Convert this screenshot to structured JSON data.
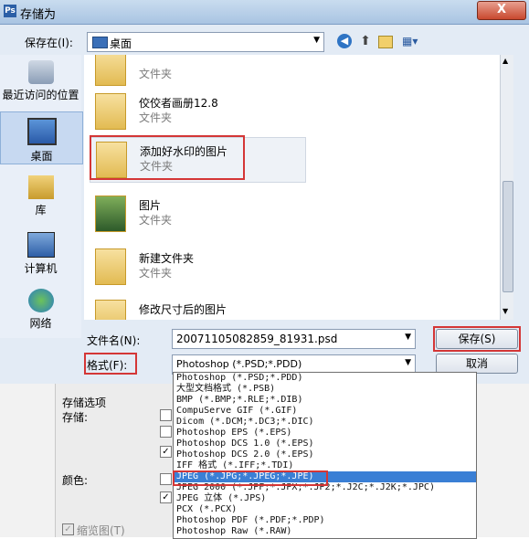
{
  "window": {
    "title": "存储为",
    "close": "X",
    "app_icon": "Ps"
  },
  "toolbar": {
    "save_in_label": "保存在(I):",
    "location": "桌面",
    "nav_icons": [
      "back-icon",
      "up-icon",
      "new-folder-icon",
      "view-menu-icon"
    ]
  },
  "sidebar": {
    "items": [
      {
        "label": "最近访问的位置",
        "icon": "recent-places-icon"
      },
      {
        "label": "桌面",
        "icon": "desktop-icon",
        "selected": true
      },
      {
        "label": "库",
        "icon": "library-icon"
      },
      {
        "label": "计算机",
        "icon": "computer-icon"
      },
      {
        "label": "网络",
        "icon": "network-icon"
      }
    ]
  },
  "files": [
    {
      "name": "",
      "type": "文件夹"
    },
    {
      "name": "佼佼者画册12.8",
      "type": "文件夹"
    },
    {
      "name": "添加好水印的图片",
      "type": "文件夹",
      "selected": true
    },
    {
      "name": "图片",
      "type": "文件夹"
    },
    {
      "name": "新建文件夹",
      "type": "文件夹"
    },
    {
      "name": "修改尺寸后的图片",
      "type": ""
    }
  ],
  "form": {
    "filename_label": "文件名(N):",
    "filename_value": "20071105082859_81931.psd",
    "format_label": "格式(F):",
    "format_value": "Photoshop (*.PSD;*.PDD)",
    "save_button": "保存(S)",
    "cancel_button": "取消"
  },
  "options": {
    "title": "存储选项",
    "storage_label": "存储:",
    "color_label": "颜色:",
    "thumbnail_label": "缩览图(T)"
  },
  "format_options": [
    "Photoshop (*.PSD;*.PDD)",
    "大型文档格式 (*.PSB)",
    "BMP (*.BMP;*.RLE;*.DIB)",
    "CompuServe GIF (*.GIF)",
    "Dicom (*.DCM;*.DC3;*.DIC)",
    "Photoshop EPS (*.EPS)",
    "Photoshop DCS 1.0 (*.EPS)",
    "Photoshop DCS 2.0 (*.EPS)",
    "IFF 格式 (*.IFF;*.TDI)",
    "JPEG (*.JPG;*.JPEG;*.JPE)",
    "JPEG 2000 (*.JPF;*.JPX;*.JP2;*.J2C;*.J2K;*.JPC)",
    "JPEG 立体 (*.JPS)",
    "PCX (*.PCX)",
    "Photoshop PDF (*.PDF;*.PDP)",
    "Photoshop Raw (*.RAW)"
  ],
  "format_selected": "JPEG (*.JPG;*.JPEG;*.JPE)",
  "colors": {
    "highlight": "#3a7fd5",
    "annotation_red": "#d43636"
  }
}
